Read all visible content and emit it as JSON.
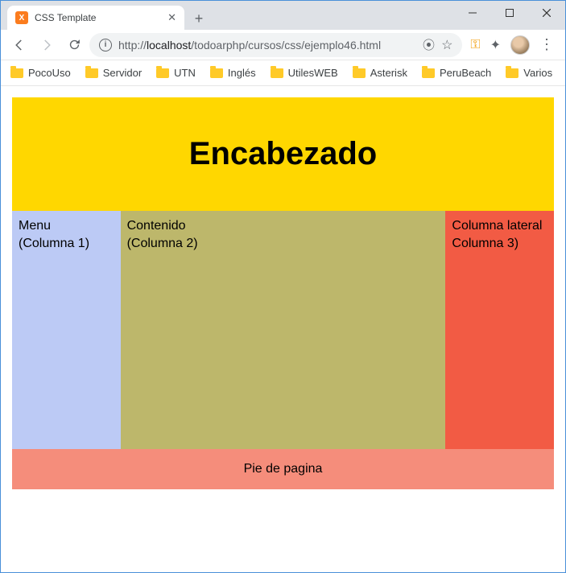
{
  "window": {
    "tab_title": "CSS Template",
    "favicon_letter": "X"
  },
  "toolbar": {
    "url_prefix": "http://",
    "url_host": "localhost",
    "url_path": "/todoarphp/cursos/css/ejemplo46.html"
  },
  "bookmarks": [
    "PocoUso",
    "Servidor",
    "UTN",
    "Inglés",
    "UtilesWEB",
    "Asterisk",
    "PeruBeach",
    "Varios"
  ],
  "page": {
    "header": "Encabezado",
    "col1_line1": "Menu",
    "col1_line2": "(Columna 1)",
    "col2_line1": "Contenido",
    "col2_line2": "(Columna 2)",
    "col3_line1": "Columna lateral",
    "col3_line2": "Columna 3)",
    "footer": "Pie de pagina"
  }
}
